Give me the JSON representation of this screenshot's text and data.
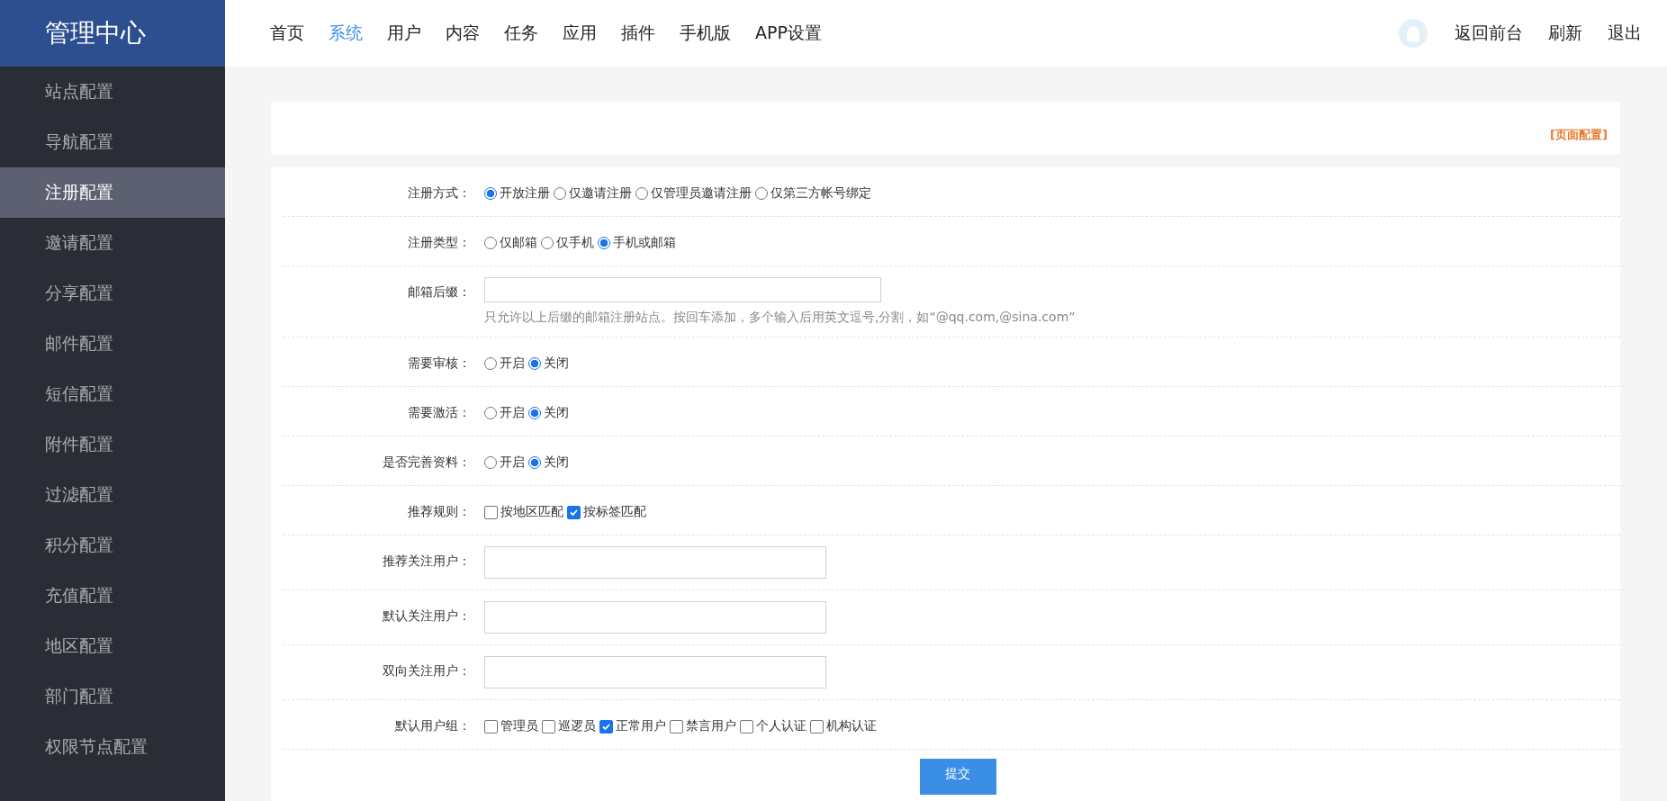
{
  "header": {
    "title": "管理中心",
    "nav": [
      {
        "label": "首页",
        "selected": false
      },
      {
        "label": "系统",
        "selected": true
      },
      {
        "label": "用户",
        "selected": false
      },
      {
        "label": "内容",
        "selected": false
      },
      {
        "label": "任务",
        "selected": false
      },
      {
        "label": "应用",
        "selected": false
      },
      {
        "label": "插件",
        "selected": false
      },
      {
        "label": "手机版",
        "selected": false
      },
      {
        "label": "APP设置",
        "selected": false
      }
    ],
    "links": [
      "返回前台",
      "刷新",
      "退出"
    ]
  },
  "sidebar": {
    "items": [
      {
        "label": "站点配置",
        "selected": false
      },
      {
        "label": "导航配置",
        "selected": false
      },
      {
        "label": "注册配置",
        "selected": true
      },
      {
        "label": "邀请配置",
        "selected": false
      },
      {
        "label": "分享配置",
        "selected": false
      },
      {
        "label": "邮件配置",
        "selected": false
      },
      {
        "label": "短信配置",
        "selected": false
      },
      {
        "label": "附件配置",
        "selected": false
      },
      {
        "label": "过滤配置",
        "selected": false
      },
      {
        "label": "积分配置",
        "selected": false
      },
      {
        "label": "充值配置",
        "selected": false
      },
      {
        "label": "地区配置",
        "selected": false
      },
      {
        "label": "部门配置",
        "selected": false
      },
      {
        "label": "权限节点配置",
        "selected": false
      }
    ]
  },
  "panel": {
    "link": "[页面配置]"
  },
  "form": {
    "rows": [
      {
        "kind": "radio",
        "label": "注册方式：",
        "options": [
          {
            "label": "开放注册",
            "selected": true
          },
          {
            "label": "仅邀请注册",
            "selected": false
          },
          {
            "label": "仅管理员邀请注册",
            "selected": false
          },
          {
            "label": "仅第三方帐号绑定",
            "selected": false
          }
        ]
      },
      {
        "kind": "radio",
        "label": "注册类型：",
        "options": [
          {
            "label": "仅邮箱",
            "selected": false
          },
          {
            "label": "仅手机",
            "selected": false
          },
          {
            "label": "手机或邮箱",
            "selected": true
          }
        ]
      },
      {
        "kind": "text",
        "label": "邮箱后缀：",
        "hint": "只允许以上后缀的邮箱注册站点。按回车添加，多个输入后用英文逗号,分割，如“@qq.com,@sina.com”"
      },
      {
        "kind": "radio",
        "label": "需要审核：",
        "options": [
          {
            "label": "开启",
            "selected": false
          },
          {
            "label": "关闭",
            "selected": true
          }
        ]
      },
      {
        "kind": "radio",
        "label": "需要激活：",
        "options": [
          {
            "label": "开启",
            "selected": false
          },
          {
            "label": "关闭",
            "selected": true
          }
        ]
      },
      {
        "kind": "radio",
        "label": "是否完善资料：",
        "options": [
          {
            "label": "开启",
            "selected": false
          },
          {
            "label": "关闭",
            "selected": true
          }
        ]
      },
      {
        "kind": "checkbox",
        "label": "推荐规则：",
        "options": [
          {
            "label": "按地区匹配",
            "checked": false
          },
          {
            "label": "按标签匹配",
            "checked": true
          }
        ]
      },
      {
        "kind": "text",
        "label": "推荐关注用户："
      },
      {
        "kind": "text",
        "label": "默认关注用户："
      },
      {
        "kind": "text",
        "label": "双向关注用户："
      },
      {
        "kind": "checkbox",
        "label": "默认用户组：",
        "options": [
          {
            "label": "管理员",
            "checked": false
          },
          {
            "label": "巡逻员",
            "checked": false
          },
          {
            "label": "正常用户",
            "checked": true
          },
          {
            "label": "禁言用户",
            "checked": false
          },
          {
            "label": "个人认证",
            "checked": false
          },
          {
            "label": "机构认证",
            "checked": false
          }
        ]
      }
    ],
    "submit": "提交"
  }
}
